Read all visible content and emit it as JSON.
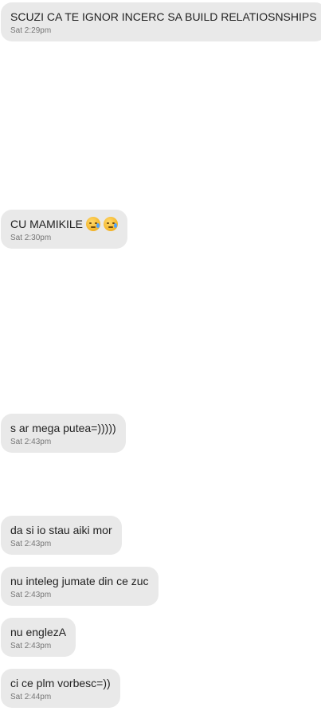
{
  "messages": [
    {
      "text": "SCUZI CA TE IGNOR INCERC SA BUILD RELATIOSNSHIPS",
      "time": "Sat 2:29pm"
    },
    {
      "text": "CU MAMIKILE",
      "time": "Sat 2:30pm",
      "emojis": [
        "sad-face-emoji",
        "sad-face-emoji"
      ]
    },
    {
      "text": "s ar mega putea=)))))",
      "time": "Sat 2:43pm"
    },
    {
      "text": "da si io stau aiki mor",
      "time": "Sat 2:43pm"
    },
    {
      "text": "nu inteleg jumate din ce zuc",
      "time": "Sat 2:43pm"
    },
    {
      "text": "nu englezA",
      "time": "Sat 2:43pm"
    },
    {
      "text": "ci ce plm vorbesc=))",
      "time": "Sat 2:44pm"
    }
  ],
  "colors": {
    "bubble_background": "#e9e9e9",
    "message_text": "#222222",
    "timestamp_text": "#777777"
  }
}
